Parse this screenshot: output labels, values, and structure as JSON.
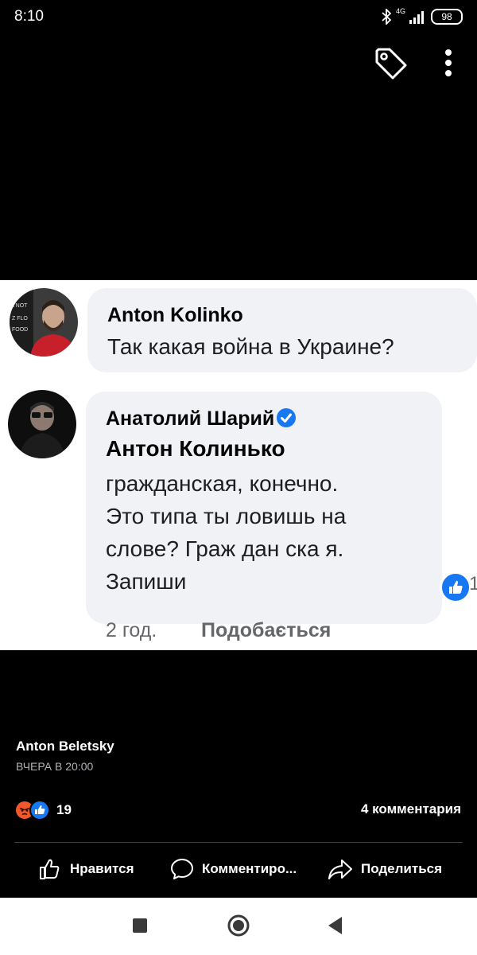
{
  "status_bar": {
    "time": "8:10",
    "network": "4G",
    "battery": "98"
  },
  "comment_screenshot": {
    "comments": [
      {
        "author": "Anton Kolinko",
        "text": "Так какая война в Украине?"
      },
      {
        "author": "Анатолий Шарий",
        "verified": true,
        "mention": "Антон Колинько",
        "text_lines": [
          "гражданская, конечно.",
          "Это типа ты ловишь на",
          "слове? Граж дан ска я.",
          "Запиши"
        ],
        "reaction_count": "1",
        "time": "2 год.",
        "like_action": "Подобається"
      }
    ]
  },
  "post": {
    "author": "Anton Beletsky",
    "posted_at": "ВЧЕРА В 20:00",
    "reaction_count": "19",
    "comments": "4 комментария"
  },
  "actions": {
    "like": "Нравится",
    "comment": "Комментиро...",
    "share": "Поделиться"
  },
  "colors": {
    "accent": "#1877f2",
    "angry": "#f0582c",
    "bubble": "#f0f2f5"
  },
  "icons": [
    "bluetooth-icon",
    "signal-icon",
    "battery-icon",
    "tag-icon",
    "more-icon",
    "verified-icon",
    "like-icon",
    "angry-icon",
    "comment-icon",
    "share-icon",
    "square-icon",
    "home-icon",
    "back-icon"
  ]
}
